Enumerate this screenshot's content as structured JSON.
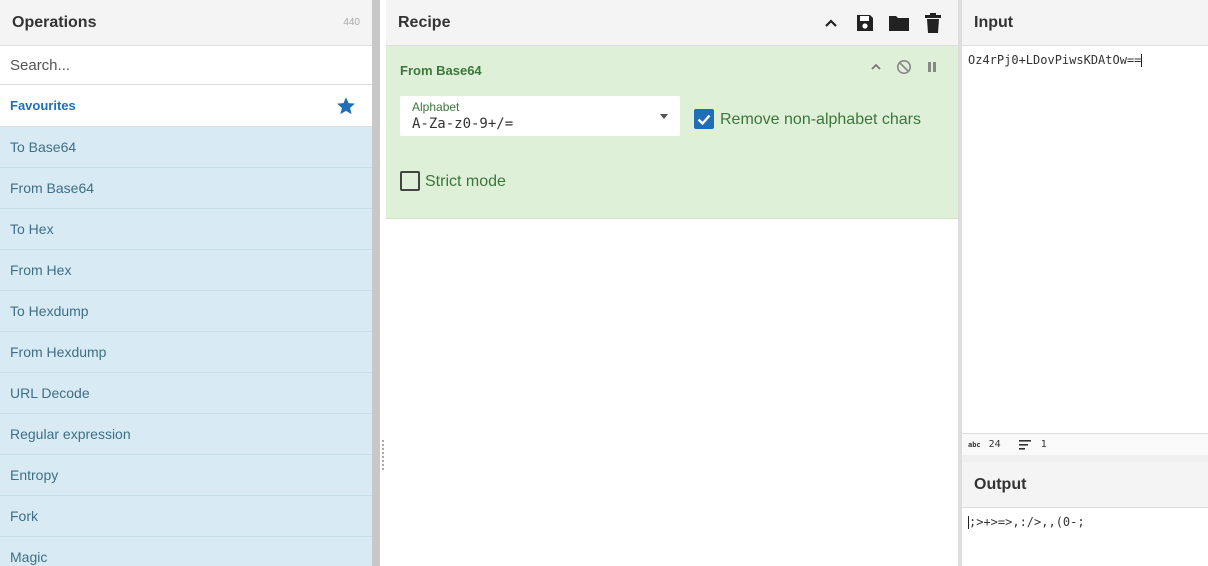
{
  "operations": {
    "title": "Operations",
    "count": "440",
    "search_placeholder": "Search...",
    "favourites_label": "Favourites",
    "items": [
      {
        "label": "To Base64"
      },
      {
        "label": "From Base64"
      },
      {
        "label": "To Hex"
      },
      {
        "label": "From Hex"
      },
      {
        "label": "To Hexdump"
      },
      {
        "label": "From Hexdump"
      },
      {
        "label": "URL Decode"
      },
      {
        "label": "Regular expression"
      },
      {
        "label": "Entropy"
      },
      {
        "label": "Fork"
      },
      {
        "label": "Magic"
      }
    ]
  },
  "recipe": {
    "title": "Recipe",
    "operation": {
      "name": "From Base64",
      "alphabet_label": "Alphabet",
      "alphabet_value": "A-Za-z0-9+/=",
      "remove_label": "Remove non-alphabet chars",
      "remove_checked": true,
      "strict_label": "Strict mode",
      "strict_checked": false
    }
  },
  "input": {
    "title": "Input",
    "text": "Oz4rPj0+LDovPiwsKDAtOw==",
    "length": "24",
    "lines": "1"
  },
  "output": {
    "title": "Output",
    "text": ";>+>=>,:/>,,(0-;"
  },
  "colors": {
    "accent": "#1e6fb8",
    "op_bg": "#d8ebf4",
    "recipe_bg": "#dff0d8",
    "recipe_text": "#3c763d"
  },
  "icons": [
    "star-icon",
    "chevron-up-icon",
    "save-icon",
    "folder-icon",
    "trash-icon",
    "disable-icon",
    "pause-icon",
    "check-icon",
    "lines-icon"
  ]
}
